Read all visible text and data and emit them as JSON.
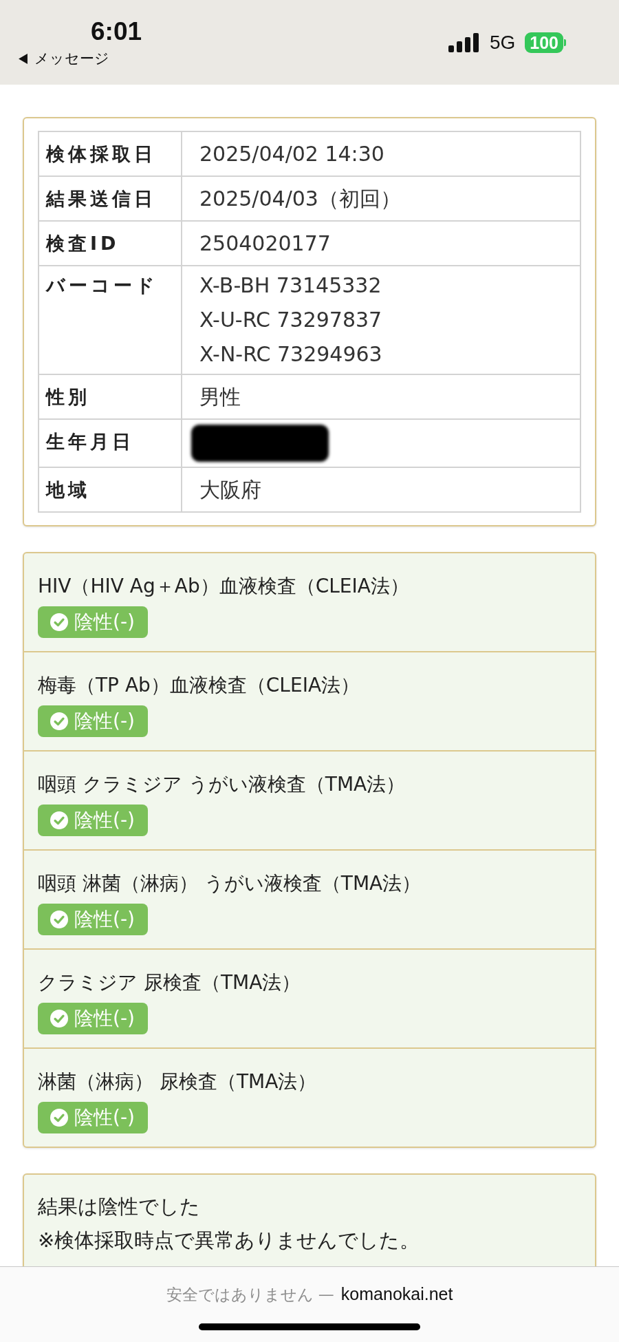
{
  "status_bar": {
    "time": "6:01",
    "back_label": "メッセージ",
    "network": "5G",
    "battery": "100"
  },
  "patient_info": {
    "rows": [
      {
        "label": "検体採取日",
        "values": [
          "2025/04/02 14:30"
        ],
        "redacted": false
      },
      {
        "label": "結果送信日",
        "values": [
          "2025/04/03（初回）"
        ],
        "redacted": false
      },
      {
        "label": "検査ID",
        "values": [
          "2504020177"
        ],
        "redacted": false
      },
      {
        "label": "バーコード",
        "values": [
          "X-B-BH 73145332",
          "X-U-RC 73297837",
          "X-N-RC 73294963"
        ],
        "redacted": false
      },
      {
        "label": "性別",
        "values": [
          "男性"
        ],
        "redacted": false
      },
      {
        "label": "生年月日",
        "redacted": true
      },
      {
        "label": "地域",
        "values": [
          "大阪府"
        ],
        "redacted": false
      }
    ]
  },
  "tests": [
    {
      "name": "HIV（HIV Ag＋Ab）血液検査（CLEIA法）",
      "result": "陰性(-)"
    },
    {
      "name": "梅毒（TP Ab）血液検査（CLEIA法）",
      "result": "陰性(-)"
    },
    {
      "name": "咽頭 クラミジア うがい液検査（TMA法）",
      "result": "陰性(-)"
    },
    {
      "name": "咽頭 淋菌（淋病） うがい液検査（TMA法）",
      "result": "陰性(-)"
    },
    {
      "name": "クラミジア 尿検査（TMA法）",
      "result": "陰性(-)"
    },
    {
      "name": "淋菌（淋病） 尿検査（TMA法）",
      "result": "陰性(-)"
    }
  ],
  "summary": {
    "lines": [
      "結果は陰性でした",
      "※検体採取時点で異常ありませんでした。"
    ]
  },
  "browser_bar": {
    "security_note": "安全ではありません —",
    "domain": "komanokai.net"
  }
}
